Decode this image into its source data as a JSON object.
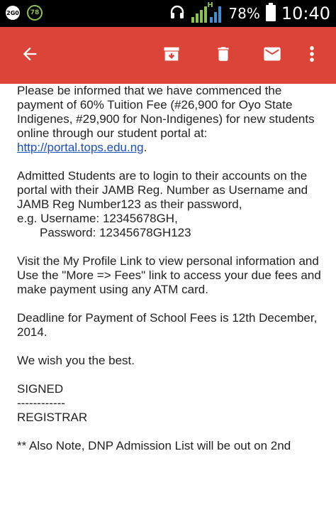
{
  "status_bar": {
    "speed_badge": "2G0",
    "notify_count": "78",
    "network_letter": "H",
    "battery_percent": "78%",
    "time": "10:40",
    "icons": [
      "headset-icon",
      "signal-icon",
      "battery-icon"
    ]
  },
  "toolbar": {
    "icons": [
      "back-arrow-icon",
      "archive-icon",
      "trash-icon",
      "mail-icon",
      "more-vert-icon"
    ],
    "color": "#db4437"
  },
  "email": {
    "p1_text": "Please be informed that we have commenced the payment of 60% Tuition Fee (#26,900 for Oyo State Indigenes, #29,900 for Non-Indigenes) for new students online through our student portal at: ",
    "p1_link": "http://portal.tops.edu.ng",
    "p1_end": ".",
    "p2_text": "Admitted Students are to login to their accounts on the portal with their JAMB Reg. Number as Username and JAMB Reg Number123 as their password,",
    "p2_example_user": "e.g. Username: 12345678GH,",
    "p2_example_pass": "Password: 12345678GH123",
    "p3_text": "Visit the My Profile Link to view personal information and Use the \"More => Fees\" link to access your due fees and make payment using any ATM card.",
    "p4_text": "Deadline for Payment of School Fees is 12th December, 2014.",
    "p5_text": "We wish you the best.",
    "signed": "SIGNED",
    "dashes": "------------",
    "registrar": "REGISTRAR",
    "note": "** Also Note, DNP Admission List will be out on 2nd"
  }
}
